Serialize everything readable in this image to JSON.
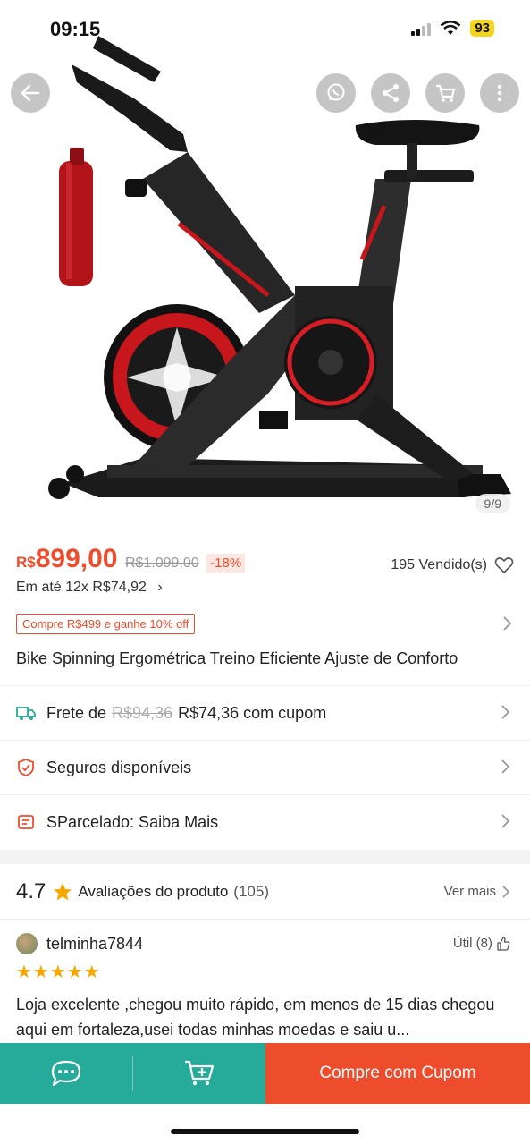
{
  "status_bar": {
    "time": "09:15",
    "battery": "93"
  },
  "hero": {
    "image_counter": "9/9"
  },
  "top_actions": [
    "back-icon",
    "whatsapp-share-icon",
    "share-icon",
    "cart-icon",
    "more-icon"
  ],
  "price": {
    "currency": "R$",
    "amount": "899,00",
    "old_price": "R$1.099,00",
    "discount": "-18%",
    "sold": "195 Vendido(s)",
    "installments": "Em até 12x R$74,92"
  },
  "coupon_tag": "Compre R$499 e ganhe 10% off",
  "product_title": "Bike Spinning Ergométrica Treino Eficiente Ajuste de Conforto",
  "shipping": {
    "label": "Frete de",
    "old": "R$94,36",
    "new": "R$74,36 com cupom"
  },
  "insurance": {
    "label": "Seguros disponíveis"
  },
  "sparcelado": {
    "label": "SParcelado: Saiba Mais"
  },
  "ratings": {
    "score": "4.7",
    "label": "Avaliações do produto",
    "count": "(105)",
    "see_more": "Ver mais"
  },
  "review": {
    "username": "telminha7844",
    "useful": "Útil (8)",
    "stars": "★★★★★",
    "text": "Loja excelente ,chegou muito rápido, em menos de 15 dias chegou aqui em fortaleza,usei todas minhas moedas e saiu u..."
  },
  "bottom_bar": {
    "buy_label": "Compre com Cupom"
  },
  "colors": {
    "accent": "#ee4d2d",
    "teal": "#26aa99",
    "star": "#f6a700"
  }
}
